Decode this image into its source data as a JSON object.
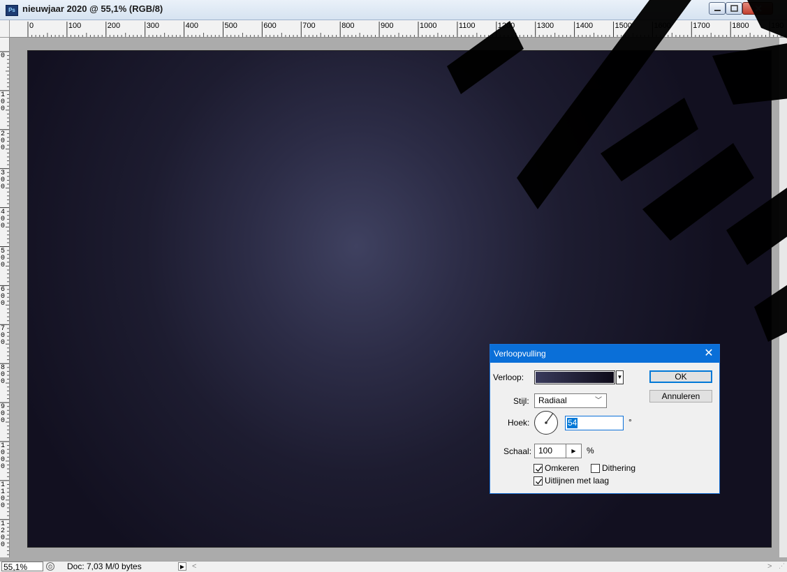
{
  "window": {
    "app_icon": "Ps",
    "title": "nieuwjaar 2020 @ 55,1% (RGB/8)"
  },
  "ruler_top": {
    "labels": [
      "0",
      "100",
      "200",
      "300",
      "400",
      "500",
      "600",
      "700",
      "800",
      "900",
      "1000",
      "1100",
      "1200",
      "1300",
      "1400",
      "1500",
      "1600",
      "1700",
      "1800",
      "190"
    ]
  },
  "ruler_left": {
    "labels": [
      "0",
      "100",
      "200",
      "300",
      "400",
      "500",
      "600",
      "700",
      "800",
      "900",
      "1000",
      "1100",
      "1200",
      "1"
    ]
  },
  "status": {
    "zoom": "55,1%",
    "doc_info": "Doc: 7,03 M/0 bytes"
  },
  "dialog": {
    "title": "Verloopvulling",
    "gradient_label": "Verloop:",
    "style_label": "Stijl:",
    "style_value": "Radiaal",
    "angle_label": "Hoek:",
    "angle_value": "54",
    "degree_sign": "°",
    "scale_label": "Schaal:",
    "scale_value": "100",
    "percent_sign": "%",
    "reverse_label": "Omkeren",
    "reverse_checked": true,
    "dither_label": "Dithering",
    "dither_checked": false,
    "align_label": "Uitlijnen met laag",
    "align_checked": true,
    "ok_label": "OK",
    "cancel_label": "Annuleren",
    "close_glyph": "✕"
  },
  "colors": {
    "title_accent": "#0a6fd8",
    "gradient_start": "#3a3b5c",
    "gradient_end": "#0d0a18"
  }
}
